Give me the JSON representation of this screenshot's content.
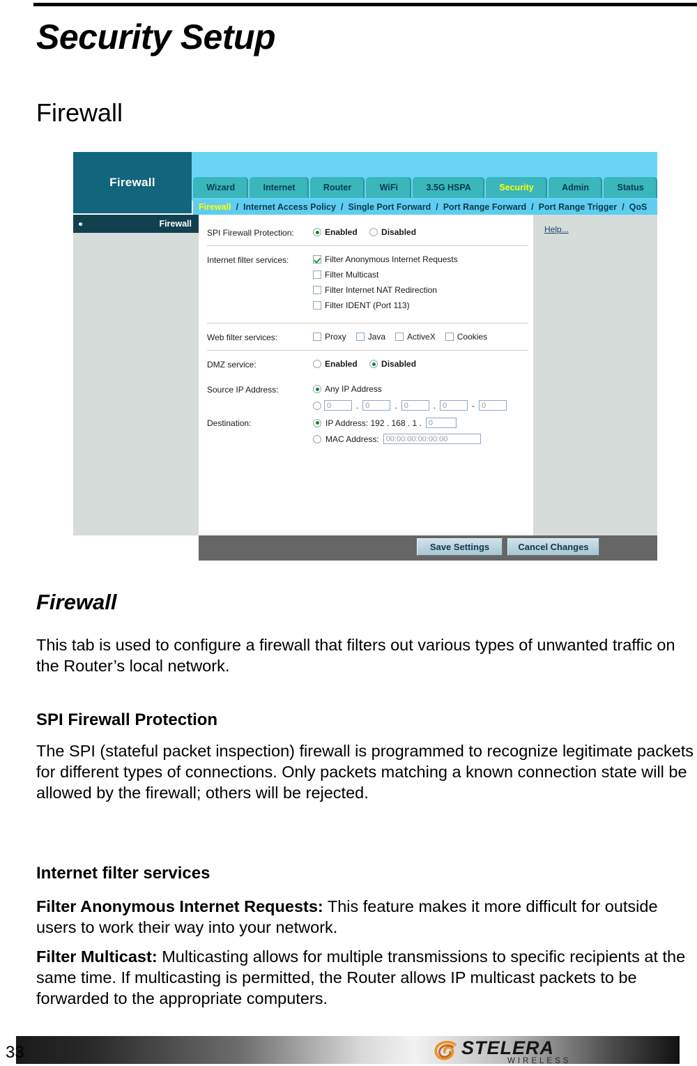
{
  "document": {
    "title": "Security Setup",
    "section_heading": "Firewall",
    "page_number": "33"
  },
  "screenshot": {
    "brand_title": "Firewall",
    "tabs": [
      {
        "label": "Wizard",
        "active": false
      },
      {
        "label": "Internet",
        "active": false
      },
      {
        "label": "Router",
        "active": false
      },
      {
        "label": "WiFi",
        "active": false
      },
      {
        "label": "3.5G HSPA",
        "active": false
      },
      {
        "label": "Security",
        "active": true
      },
      {
        "label": "Admin",
        "active": false
      },
      {
        "label": "Status",
        "active": false
      }
    ],
    "subnav": [
      {
        "label": "Firewall",
        "active": true
      },
      {
        "label": "Internet Access Policy",
        "active": false
      },
      {
        "label": "Single Port Forward",
        "active": false
      },
      {
        "label": "Port Range Forward",
        "active": false
      },
      {
        "label": "Port Range Trigger",
        "active": false
      },
      {
        "label": "QoS",
        "active": false
      }
    ],
    "subnav_separator": "/",
    "sidebar": {
      "header_label": "Firewall"
    },
    "help": {
      "link_label": "Help..."
    },
    "form": {
      "spi": {
        "label": "SPI Firewall Protection:",
        "enabled_label": "Enabled",
        "disabled_label": "Disabled",
        "selected": "Enabled"
      },
      "internet_filter": {
        "label": "Internet filter services:",
        "options": [
          {
            "label": "Filter Anonymous Internet Requests",
            "checked": true
          },
          {
            "label": "Filter Multicast",
            "checked": false
          },
          {
            "label": "Filter Internet NAT Redirection",
            "checked": false
          },
          {
            "label": "Filter IDENT (Port 113)",
            "checked": false
          }
        ]
      },
      "web_filter": {
        "label": "Web filter services:",
        "options": [
          {
            "label": "Proxy",
            "checked": false
          },
          {
            "label": "Java",
            "checked": false
          },
          {
            "label": "ActiveX",
            "checked": false
          },
          {
            "label": "Cookies",
            "checked": false
          }
        ]
      },
      "dmz": {
        "label": "DMZ service:",
        "enabled_label": "Enabled",
        "disabled_label": "Disabled",
        "selected": "Disabled"
      },
      "source_ip": {
        "label": "Source IP Address:",
        "any_label": "Any IP Address",
        "any_selected": true,
        "range_selected": false,
        "octets": [
          "0",
          "0",
          "0",
          "0"
        ],
        "range_end": "0",
        "dot": ".",
        "dash": "-"
      },
      "destination": {
        "label": "Destination:",
        "ip_label": "IP Address: 192 . 168 . 1 .",
        "ip_last_octet": "0",
        "ip_selected": true,
        "mac_label": "MAC Address:",
        "mac_value": "00:00:00:00:00:00",
        "mac_selected": false
      }
    },
    "buttons": {
      "save": "Save Settings",
      "cancel": "Cancel Changes"
    }
  },
  "body": {
    "heading_firewall": "Firewall",
    "intro": "This tab is used to configure a firewall that filters out various types of unwanted traffic on the Router’s local network.",
    "spi_heading": "SPI Firewall Protection",
    "spi_text": "The SPI (stateful packet inspection) firewall is programmed to recognize legitimate packets for different types of connections. Only packets matching a known connection state will be allowed by the firewall; others will be rejected.",
    "internet_filter_heading": "Internet filter services",
    "anon_bold": "Filter Anonymous Internet Requests:",
    "anon_text": " This feature makes it more difficult for outside users to work their way into your network.",
    "multicast_bold": "Filter Multicast:",
    "multicast_text": " Multicasting allows for multiple transmissions to specific recipients at the same time. If multicasting is permitted, the Router allows IP multicast packets to be forwarded to the appropriate computers."
  },
  "footer": {
    "logo_name": "STELERA",
    "logo_sub": "WIRELESS"
  }
}
